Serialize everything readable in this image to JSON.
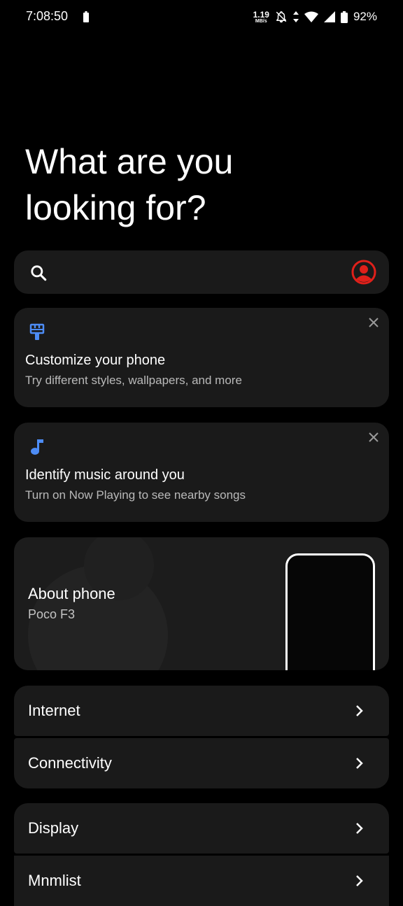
{
  "status_bar": {
    "time": "7:08:50",
    "net_speed_value": "1.19",
    "net_speed_unit": "MB/s",
    "battery_percent": "92%"
  },
  "headline": {
    "line1": "What are you",
    "line2": "looking for?"
  },
  "search": {
    "icon": "search-icon",
    "account_icon": "account-circle-icon",
    "account_color": "#e0201a"
  },
  "suggestions": [
    {
      "icon": "paint-brush-icon",
      "title": "Customize your phone",
      "subtitle": "Try different styles, wallpapers, and more",
      "icon_color": "#4d8cf5"
    },
    {
      "icon": "music-note-icon",
      "title": "Identify music around you",
      "subtitle": "Turn on Now Playing to see nearby songs",
      "icon_color": "#4d8cf5"
    }
  ],
  "about": {
    "title": "About phone",
    "subtitle": "Poco F3"
  },
  "settings": [
    {
      "label": "Internet"
    },
    {
      "label": "Connectivity"
    },
    {
      "label": "Display"
    },
    {
      "label": "Mnmlist"
    }
  ]
}
